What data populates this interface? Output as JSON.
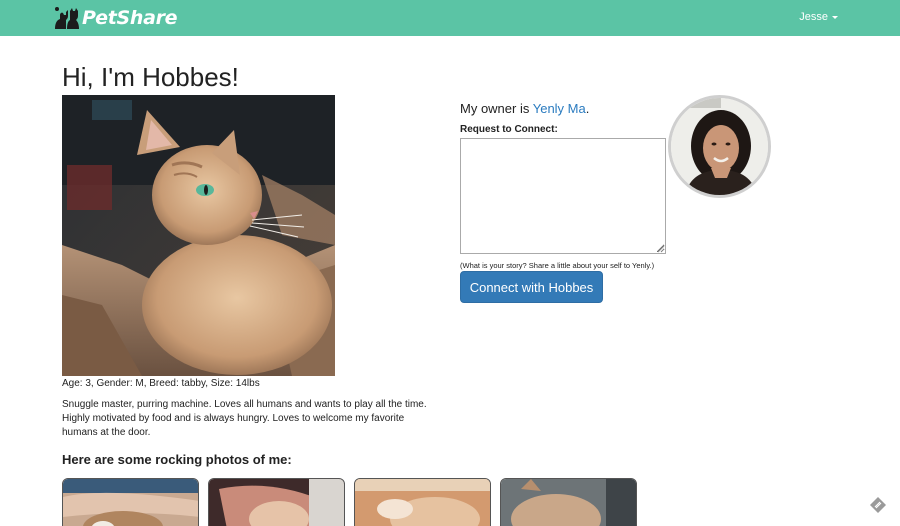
{
  "app": {
    "brand": "PetShare",
    "user_name": "Jesse"
  },
  "profile": {
    "title": "Hi, I'm Hobbes!",
    "stats": "Age: 3, Gender: M, Breed: tabby, Size: 14lbs",
    "bio": "Snuggle master, purring machine. Loves all humans and wants to play all the time. Highly motivated by food and is always hungry. Loves to welcome my favorite humans at the door.",
    "photos_heading": "Here are some rocking photos of me:"
  },
  "owner": {
    "prefix": "My owner is ",
    "name": "Yenly Ma",
    "suffix": "."
  },
  "request": {
    "label": "Request to Connect:",
    "textarea_value": "",
    "help_text": "(What is your story? Share a little about your self to Yenly.)",
    "button_label": "Connect with Hobbes"
  },
  "colors": {
    "navbar": "#5bc4a5",
    "link": "#2a7bbf",
    "button": "#337ab7"
  },
  "icons": [
    "petshare-logo-icon",
    "caret-down-icon",
    "resize-grip-icon",
    "feedback-badge-icon"
  ]
}
